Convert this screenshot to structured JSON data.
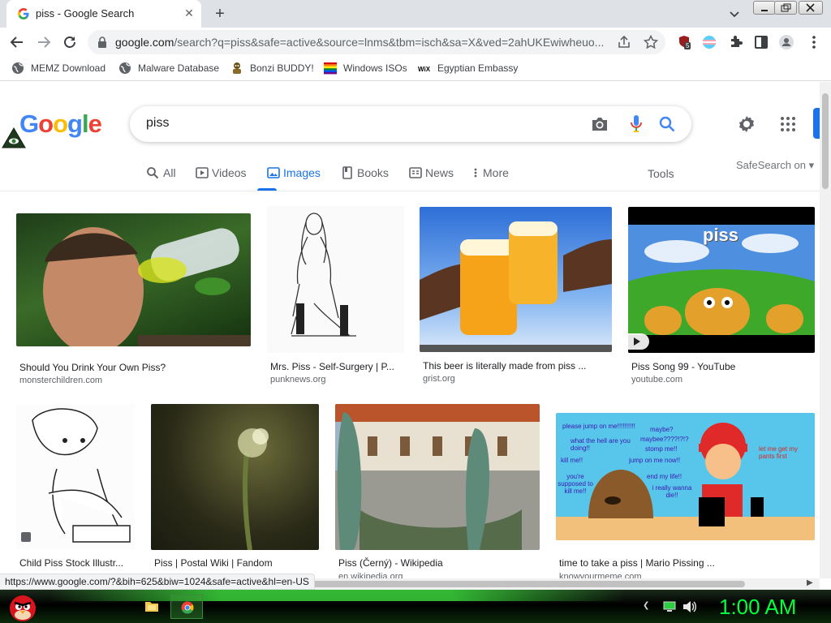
{
  "browser": {
    "tab_title": "piss - Google Search",
    "url_host": "google.com",
    "url_rest": "/search?q=piss&safe=active&source=lnms&tbm=isch&sa=X&ved=2ahUKEwiwheuo...",
    "extension_badge": "5",
    "bookmarks": [
      {
        "label": "MEMZ Download",
        "icon": "globe-icon"
      },
      {
        "label": "Malware Database",
        "icon": "globe-icon"
      },
      {
        "label": "Bonzi BUDDY!",
        "icon": "bonzi-icon"
      },
      {
        "label": "Windows ISOs",
        "icon": "windows-flag-icon"
      },
      {
        "label": "Egyptian Embassy",
        "icon": "wix-icon"
      }
    ],
    "status_url": "https://www.google.com/?&bih=625&biw=1024&safe=active&hl=en-US"
  },
  "google": {
    "logo": "Google",
    "query": "piss",
    "tabs": [
      {
        "label": "All",
        "icon": "search-icon",
        "active": false
      },
      {
        "label": "Videos",
        "icon": "video-icon",
        "active": false
      },
      {
        "label": "Images",
        "icon": "image-icon",
        "active": true
      },
      {
        "label": "Books",
        "icon": "book-icon",
        "active": false
      },
      {
        "label": "News",
        "icon": "news-icon",
        "active": false
      },
      {
        "label": "More",
        "icon": "more-vert-icon",
        "active": false
      }
    ],
    "tools_label": "Tools",
    "safesearch_label": "SafeSearch on"
  },
  "results": [
    {
      "title": "Should You Drink Your Own Piss?",
      "source": "monsterchildren.com"
    },
    {
      "title": "Mrs. Piss - Self-Surgery | P...",
      "source": "punknews.org"
    },
    {
      "title": "This beer is literally made from piss ...",
      "source": "grist.org"
    },
    {
      "title": "Piss Song 99 - YouTube",
      "source": "youtube.com",
      "overlay_text": "piss"
    },
    {
      "title": "Child Piss Stock Illustr...",
      "source": ""
    },
    {
      "title": "Piss | Postal Wiki | Fandom",
      "source": ""
    },
    {
      "title": "Piss (Černý) - Wikipedia",
      "source": "en.wikipedia.org"
    },
    {
      "title": "time to take a piss | Mario Pissing ...",
      "source": "knowyourmeme.com",
      "meme_text": [
        "please jump on me!!!!!!!!!!",
        "maybe?",
        "what the hell are you doing!!",
        "maybee????!?!?",
        "stomp me!!",
        "kill me!!",
        "jump on me now!!",
        "let me get my pants first",
        "you're supposed to kill me!!",
        "end my life!!",
        "i really wanna die!!"
      ]
    }
  ],
  "taskbar": {
    "clock": "1:00 AM"
  },
  "colors": {
    "google_blue": "#4285f4",
    "google_red": "#ea4335",
    "google_yellow": "#fbbc05",
    "google_green": "#34a853",
    "clock_green": "#00ff3c"
  }
}
